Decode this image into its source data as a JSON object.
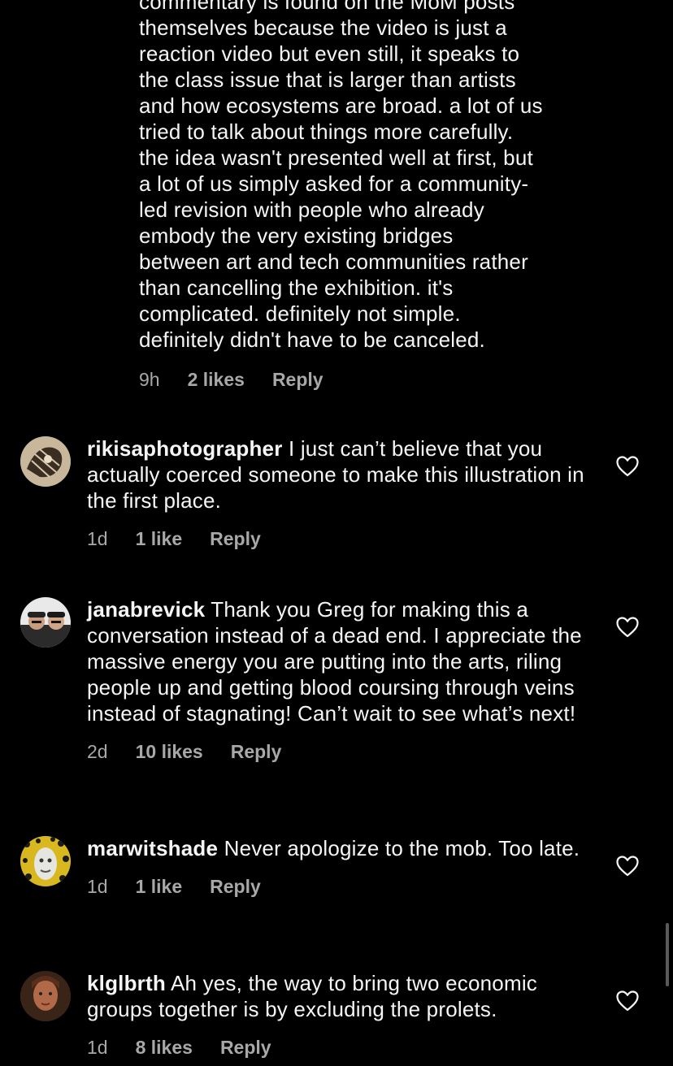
{
  "reply": {
    "text": "commentary is found on the MoM posts themselves because the video is just a reaction video but even still, it speaks to the class issue that is larger than artists and how ecosystems are broad. a lot of us tried to talk about things more carefully. the idea wasn't presented well at first, but a lot of us simply asked for a community-led revision with people who already embody the very existing bridges between art and tech communities rather than cancelling the exhibition. it's complicated. definitely not simple. definitely didn't have to be canceled.",
    "lines": [
      "commentary is found on the MoM posts",
      "themselves because the video is just a",
      "reaction video but even still, it speaks to",
      "the class issue that is larger than artists",
      "and how ecosystems are broad. a lot of us",
      "tried to talk about things more carefully.",
      "the idea wasn't presented well at first, but",
      "a lot of us simply asked for a community-",
      "led revision with people who already",
      "embody the very existing bridges",
      "between art and tech communities rather",
      "than cancelling the exhibition. it's",
      "complicated. definitely not simple.",
      "definitely didn't have to be canceled."
    ],
    "time": "9h",
    "likes": "2 likes",
    "reply_label": "Reply"
  },
  "comments": [
    {
      "username": "rikisaphotographer",
      "text": "I just can’t believe that you actually coerced someone to make this illustration in the first place.",
      "time": "1d",
      "likes": "1 like",
      "reply_label": "Reply",
      "avatar_icon": "avatar-illustration"
    },
    {
      "username": "janabrevick",
      "text": "Thank you Greg for making this a conversation instead of a dead end. I appreciate the massive energy you are putting into the arts, riling people up and getting blood coursing through veins instead of stagnating! Can’t wait to see what’s next!",
      "time": "2d",
      "likes": "10 likes",
      "reply_label": "Reply",
      "avatar_icon": "avatar-photo"
    },
    {
      "username": "marwitshade",
      "text": "Never apologize to the mob. Too late.",
      "time": "1d",
      "likes": "1 like",
      "reply_label": "Reply",
      "avatar_icon": "avatar-pattern"
    },
    {
      "username": "klglbrth",
      "text": "Ah yes, the way to bring two economic groups together is by excluding the prolets.",
      "time": "1d",
      "likes": "8 likes",
      "reply_label": "Reply",
      "avatar_icon": "avatar-portrait"
    }
  ],
  "icons": {
    "like": "heart-outline-icon"
  },
  "colors": {
    "background": "#000000",
    "text": "#f5f5f5",
    "meta": "#a8a8a8"
  }
}
